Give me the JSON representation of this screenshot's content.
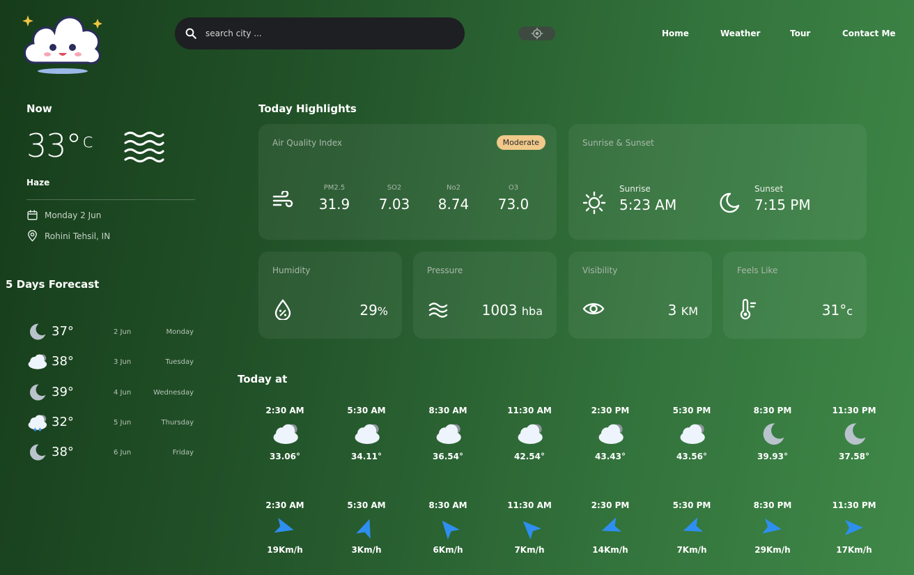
{
  "header": {
    "search_placeholder": "search city ...",
    "nav": [
      "Home",
      "Weather",
      "Tour",
      "Contact Me"
    ]
  },
  "current": {
    "label": "Now",
    "temp": "33°",
    "unit": "c",
    "condition": "Haze",
    "date": "Monday 2 Jun",
    "location": "Rohini Tehsil, IN"
  },
  "forecast": {
    "title": "5 Days Forecast",
    "days": [
      {
        "icon": "moon-icon",
        "temp": "37°",
        "date": "2 Jun",
        "day": "Monday"
      },
      {
        "icon": "cloud-icon",
        "temp": "38°",
        "date": "3 Jun",
        "day": "Tuesday"
      },
      {
        "icon": "moon-icon",
        "temp": "39°",
        "date": "4 Jun",
        "day": "Wednesday"
      },
      {
        "icon": "rain-cloud-icon",
        "temp": "32°",
        "date": "5 Jun",
        "day": "Thursday"
      },
      {
        "icon": "moon-icon",
        "temp": "38°",
        "date": "6 Jun",
        "day": "Friday"
      }
    ]
  },
  "highlights": {
    "title": "Today Highlights",
    "aqi": {
      "label": "Air Quality Index",
      "badge": "Moderate",
      "items": [
        {
          "key": "PM2.5",
          "value": "31.9"
        },
        {
          "key": "SO2",
          "value": "7.03"
        },
        {
          "key": "No2",
          "value": "8.74"
        },
        {
          "key": "O3",
          "value": "73.0"
        }
      ]
    },
    "sun": {
      "label": "Sunrise & Sunset",
      "sunrise_label": "Sunrise",
      "sunrise": "5:23 AM",
      "sunset_label": "Sunset",
      "sunset": "7:15 PM"
    },
    "humidity": {
      "label": "Humidity",
      "value": "29",
      "unit": "%"
    },
    "pressure": {
      "label": "Pressure",
      "value": "1003",
      "unit": "hba"
    },
    "visibility": {
      "label": "Visibility",
      "value": "3",
      "unit": "KM"
    },
    "feels_like": {
      "label": "Feels Like",
      "value": "31°",
      "unit": "c"
    }
  },
  "today": {
    "title": "Today at",
    "temps": [
      {
        "time": "2:30 AM",
        "icon": "cloud-icon",
        "value": "33.06°"
      },
      {
        "time": "5:30 AM",
        "icon": "cloud-icon",
        "value": "34.11°"
      },
      {
        "time": "8:30 AM",
        "icon": "cloud-icon",
        "value": "36.54°"
      },
      {
        "time": "11:30 AM",
        "icon": "cloud-icon",
        "value": "42.54°"
      },
      {
        "time": "2:30 PM",
        "icon": "cloud-icon",
        "value": "43.43°"
      },
      {
        "time": "5:30 PM",
        "icon": "cloud-icon",
        "value": "43.56°"
      },
      {
        "time": "8:30 PM",
        "icon": "moon-icon",
        "value": "39.93°"
      },
      {
        "time": "11:30 PM",
        "icon": "moon-icon",
        "value": "37.58°"
      }
    ],
    "wind": [
      {
        "time": "2:30 AM",
        "value": "19Km/h",
        "deg": 15
      },
      {
        "time": "5:30 AM",
        "value": "3Km/h",
        "deg": -70
      },
      {
        "time": "8:30 AM",
        "value": "6Km/h",
        "deg": -130
      },
      {
        "time": "11:30 AM",
        "value": "7Km/h",
        "deg": -135
      },
      {
        "time": "2:30 PM",
        "value": "14Km/h",
        "deg": 160
      },
      {
        "time": "5:30 PM",
        "value": "7Km/h",
        "deg": 160
      },
      {
        "time": "8:30 PM",
        "value": "29Km/h",
        "deg": 10
      },
      {
        "time": "11:30 PM",
        "value": "17Km/h",
        "deg": 0
      }
    ]
  },
  "colors": {
    "accent_blue": "#2e8ff0",
    "badge": "#f0c98b",
    "search_bg": "#1e1f22"
  }
}
